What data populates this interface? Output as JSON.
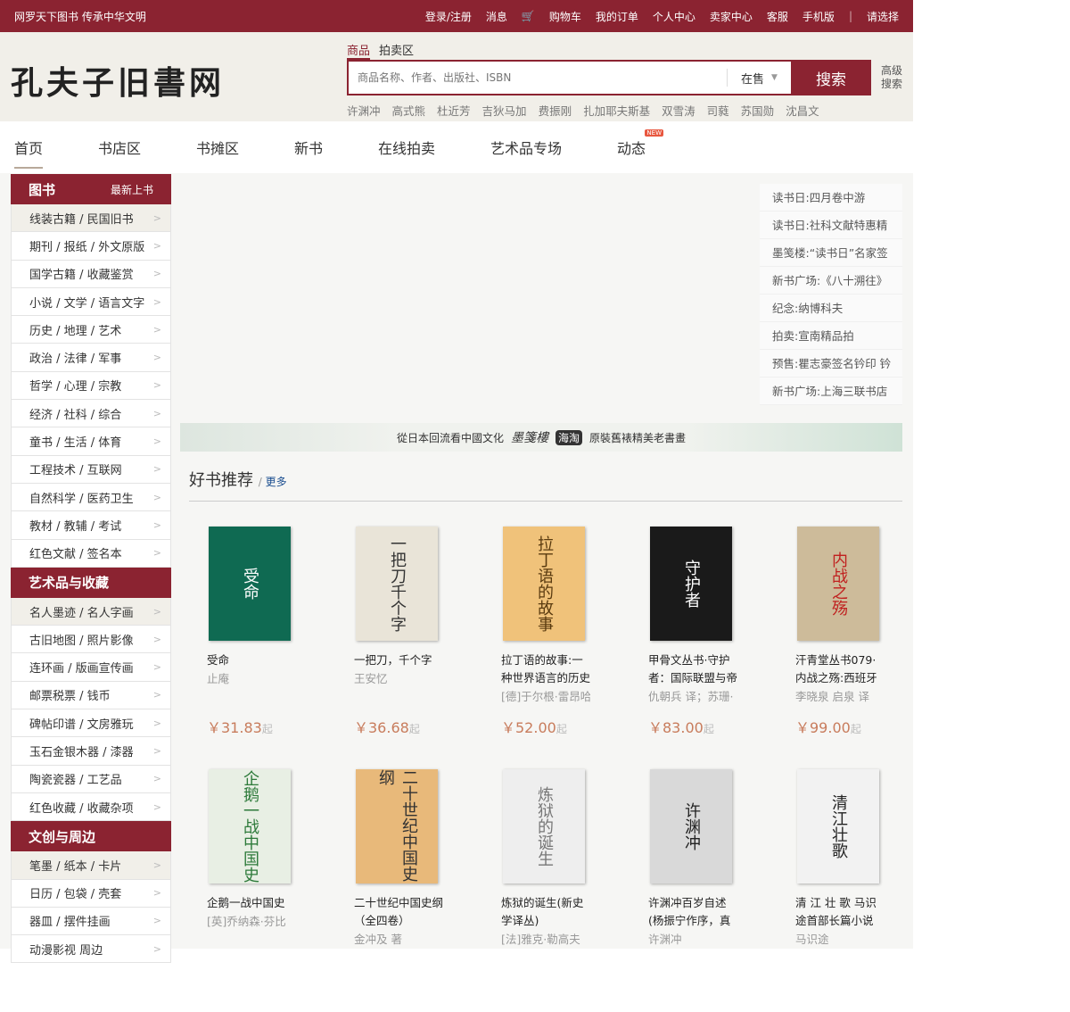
{
  "topbar": {
    "slogan": "网罗天下图书  传承中华文明",
    "links": [
      "登录/注册",
      "消息",
      "购物车",
      "我的订单",
      "个人中心",
      "卖家中心",
      "客服",
      "手机版"
    ],
    "region": "请选择"
  },
  "header": {
    "logo": "孔夫子旧書网",
    "search_tabs": [
      "商品",
      "拍卖区"
    ],
    "search_placeholder": "商品名称、作者、出版社、ISBN",
    "filter": "在售",
    "search_button": "搜索",
    "advanced": "高级搜索",
    "hot_keywords": [
      "许渊冲",
      "高式熊",
      "杜近芳",
      "吉狄马加",
      "费振刚",
      "扎加耶夫斯基",
      "双雪涛",
      "司蕤",
      "苏国勋",
      "沈昌文"
    ]
  },
  "nav": {
    "items": [
      "首页",
      "书店区",
      "书摊区",
      "新书",
      "在线拍卖",
      "艺术品专场",
      "动态"
    ],
    "new_badge": "NEW"
  },
  "sidebar": {
    "sections": [
      {
        "title": "图书",
        "extra": "最新上书",
        "items": [
          "线装古籍 / 民国旧书",
          "期刊 / 报纸 / 外文原版",
          "国学古籍 / 收藏鉴赏",
          "小说 / 文学 / 语言文字",
          "历史 / 地理 / 艺术",
          "政治 / 法律 / 军事",
          "哲学 / 心理 / 宗教",
          "经济 / 社科 / 综合",
          "童书 / 生活 / 体育",
          "工程技术 / 互联网",
          "自然科学 / 医药卫生",
          "教材 / 教辅 / 考试",
          "红色文献 / 签名本"
        ]
      },
      {
        "title": "艺术品与收藏",
        "items": [
          "名人墨迹 / 名人字画",
          "古旧地图 / 照片影像",
          "连环画 / 版画宣传画",
          "邮票税票 / 钱币",
          "碑帖印谱 / 文房雅玩",
          "玉石金银木器 / 漆器",
          "陶瓷瓷器 / 工艺品",
          "红色收藏 / 收藏杂项"
        ]
      },
      {
        "title": "文创与周边",
        "items": [
          "笔墨 / 纸本 / 卡片",
          "日历 / 包袋 / 壳套",
          "器皿 / 摆件挂画",
          "动漫影视 周边"
        ]
      }
    ]
  },
  "news": [
    "读书日:四月卷中游",
    "读书日:社科文献特惠精",
    "墨笺楼:“读书日”名家签",
    "新书广场:《八十溯往》",
    "纪念:纳博科夫",
    "拍卖:宣南精品拍",
    "预售:瞿志豪签名钤印 钤",
    "新书广场:上海三联书店"
  ],
  "banner": {
    "text1": "從日本回流看中國文化",
    "brand": "墨箋樓",
    "tag": "海淘",
    "text2": "原裝舊裱精美老書畫"
  },
  "recommend": {
    "title": "好书推荐",
    "more": "更多",
    "price_suffix": "起",
    "books": [
      {
        "title": "受命",
        "author": "止庵",
        "price": "￥31.83",
        "cover": "受命",
        "color": "#0f6a52",
        "fg": "#fff"
      },
      {
        "title": "一把刀，千个字",
        "author": "王安忆",
        "price": "￥36.68",
        "cover": "一把刀千个字",
        "color": "#e9e4d8",
        "fg": "#333"
      },
      {
        "title": "拉丁语的故事:一种世界语言的历史",
        "author": "[德]于尔根·雷昂哈",
        "price": "￥52.00",
        "cover": "拉丁语的故事",
        "color": "#f0c27a",
        "fg": "#5a3b10"
      },
      {
        "title": "甲骨文丛书·守护者：国际联盟与帝",
        "author": "仇朝兵 译；苏珊·",
        "price": "￥83.00",
        "cover": "守护者",
        "color": "#1a1a1a",
        "fg": "#fff"
      },
      {
        "title": "汗青堂丛书079·内战之殇:西班牙",
        "author": "李晓泉 启泉 译",
        "price": "￥99.00",
        "cover": "内战之殇",
        "color": "#cdbb9a",
        "fg": "#c0201f"
      },
      {
        "title": "企鹅一战中国史",
        "author": "[英]乔纳森·芬比",
        "price": "",
        "cover": "企鹅一战中国史",
        "color": "#e8efe4",
        "fg": "#2d7a3a"
      },
      {
        "title": "二十世纪中国史纲（全四卷）",
        "author": "金冲及 著",
        "price": "",
        "cover": "二十世纪中国史纲",
        "color": "#e8b97a",
        "fg": "#333"
      },
      {
        "title": "炼狱的诞生(新史学译丛)",
        "author": "[法]雅克·勒高夫",
        "price": "",
        "cover": "炼狱的诞生",
        "color": "#eeeeee",
        "fg": "#777"
      },
      {
        "title": "许渊冲百岁自述(杨振宁作序，真格",
        "author": "许渊冲",
        "price": "",
        "cover": "许渊冲",
        "color": "#d9d9d9",
        "fg": "#222"
      },
      {
        "title": "清 江 壮 歌 马识途首部长篇小说  据",
        "author": "马识途",
        "price": "",
        "cover": "清江壮歌",
        "color": "#f2f2f2",
        "fg": "#222"
      }
    ]
  },
  "colors": {
    "brand": "#8b2331",
    "price": "#c87c5c"
  }
}
